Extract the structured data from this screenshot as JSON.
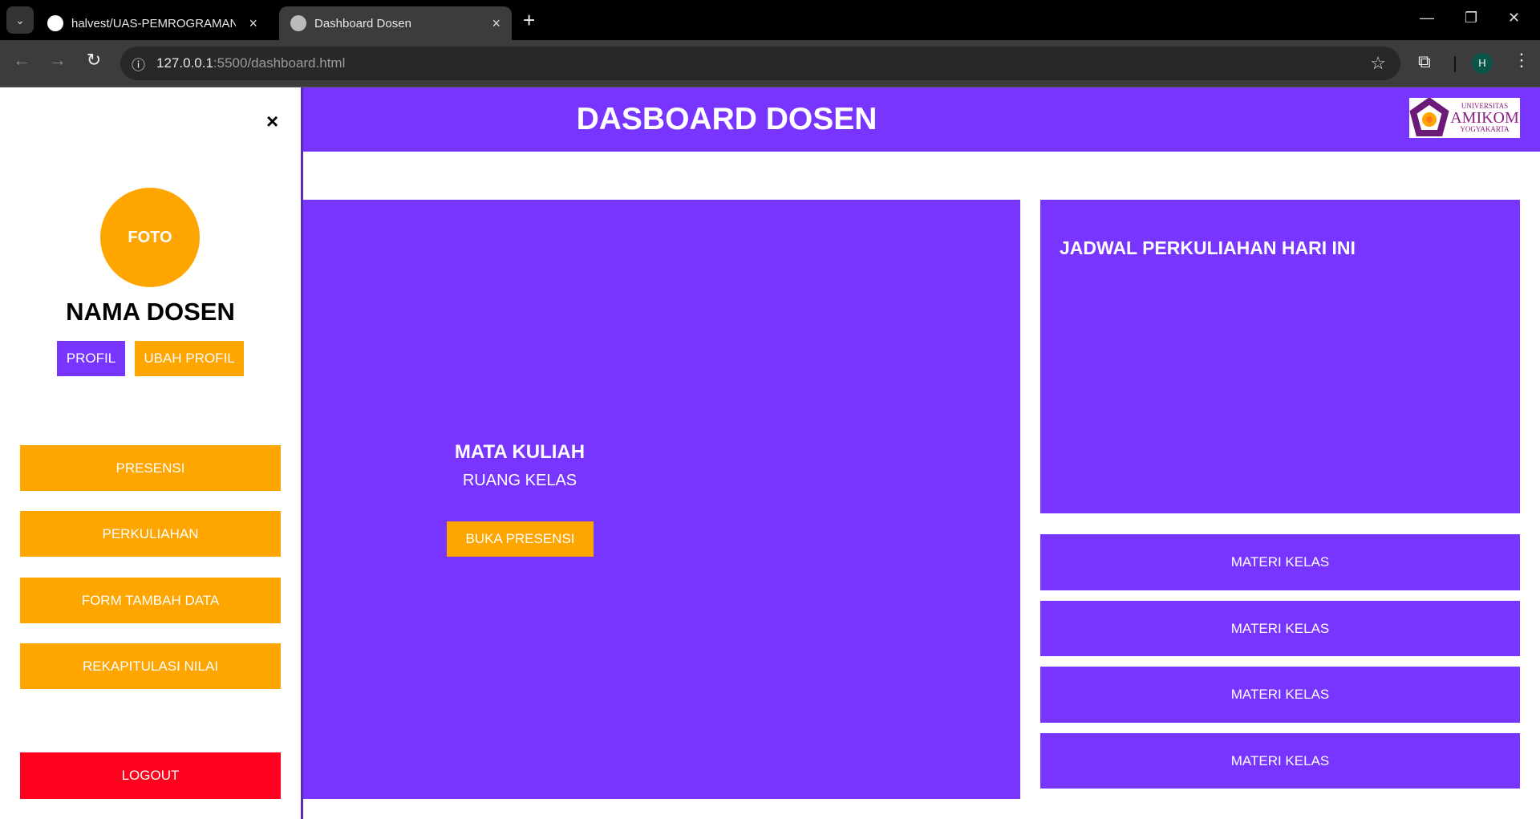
{
  "browser": {
    "tabs": [
      {
        "title": "halvest/UAS-PEMROGRAMAN-W",
        "active": false
      },
      {
        "title": "Dashboard Dosen",
        "active": true
      }
    ],
    "url_host": "127.0.0.1",
    "url_rest": ":5500/dashboard.html",
    "profile_initial": "H"
  },
  "header": {
    "title": "DASBOARD DOSEN",
    "logo": {
      "line1": "UNIVERSITAS",
      "line2": "AMIKOM",
      "line3": "YOGYAKARTA"
    }
  },
  "sidebar": {
    "close": "×",
    "photo": "FOTO",
    "name": "NAMA DOSEN",
    "profile_button": "PROFIL",
    "edit_profile_button": "UBAH PROFIL",
    "menu": [
      {
        "label": "PRESENSI"
      },
      {
        "label": "PERKULIAHAN"
      },
      {
        "label": "FORM TAMBAH DATA"
      },
      {
        "label": "REKAPITULASI NILAI"
      }
    ],
    "logout": "LOGOUT"
  },
  "main": {
    "course": {
      "title": "MATA KULIAH",
      "room": "RUANG KELAS",
      "button": "BUKA PRESENSI"
    },
    "schedule": {
      "title": "JADWAL PERKULIAHAN HARI INI"
    },
    "materials": [
      {
        "label": "MATERI KELAS"
      },
      {
        "label": "MATERI KELAS"
      },
      {
        "label": "MATERI KELAS"
      },
      {
        "label": "MATERI KELAS"
      }
    ]
  },
  "colors": {
    "purple": "#7835ff",
    "orange": "#ffa500",
    "red": "#ff001e"
  }
}
